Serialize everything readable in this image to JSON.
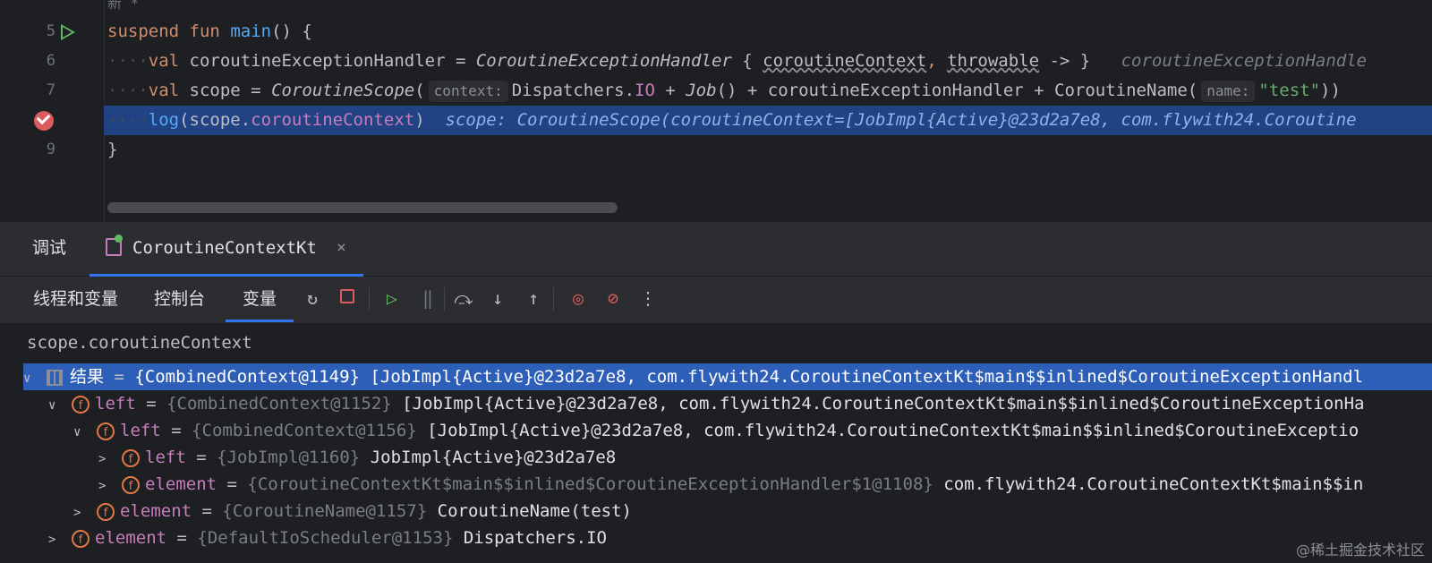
{
  "editor": {
    "header_note": "新 *",
    "lines": [
      {
        "num": "5",
        "text": ""
      },
      {
        "num": "6",
        "text": ""
      },
      {
        "num": "7",
        "text": ""
      },
      {
        "num": "",
        "text": ""
      },
      {
        "num": "9",
        "text": ""
      }
    ],
    "l5": {
      "kw1": "suspend",
      "kw2": "fun",
      "fn": "main",
      "rest": "() {"
    },
    "l6": {
      "kw": "val",
      "name": "coroutineExceptionHandler = ",
      "cls": "CoroutineExceptionHandler",
      "p1": " { ",
      "a1": "coroutineContext",
      "comma": ", ",
      "a2": "throwable",
      "p2": " -> }",
      "inline": "coroutineExceptionHandle"
    },
    "l7": {
      "kw": "val",
      "name": "scope = ",
      "cls": "CoroutineScope",
      "open": "(",
      "hint1": "context:",
      "p1": "Dispatchers.",
      "io": "IO",
      "p2": " + ",
      "job": "Job",
      "p3": "() + coroutineExceptionHandler + CoroutineName(",
      "hint2": "name:",
      "str": "\"test\"",
      "close": "))"
    },
    "l8": {
      "fn": "log",
      "p1": "(scope.",
      "prop": "coroutineContext",
      "p2": ")",
      "inline": "scope: CoroutineScope(coroutineContext=[JobImpl{Active}@23d2a7e8, com.flywith24.Coroutine"
    },
    "l9": {
      "text": "}"
    }
  },
  "debug_tabs": {
    "debug_label": "调试",
    "run_label": "CoroutineContextKt",
    "close": "×"
  },
  "toolbar": {
    "tabs": [
      "线程和变量",
      "控制台",
      "变量"
    ],
    "icons": [
      "rerun-icon",
      "stop-icon",
      "resume-icon",
      "pause-icon",
      "step-over-icon",
      "step-into-icon",
      "step-out-icon",
      "view-breakpoints-icon",
      "mute-breakpoints-icon",
      "more-icon"
    ]
  },
  "variables": {
    "expression": "scope.coroutineContext",
    "rows": [
      {
        "name": "结果",
        "type": "{CombinedContext@1149}",
        "value": "[JobImpl{Active}@23d2a7e8, com.flywith24.CoroutineContextKt$main$$inlined$CoroutineExceptionHandl"
      },
      {
        "name": "left",
        "type": "{CombinedContext@1152}",
        "value": "[JobImpl{Active}@23d2a7e8, com.flywith24.CoroutineContextKt$main$$inlined$CoroutineExceptionHa"
      },
      {
        "name": "left",
        "type": "{CombinedContext@1156}",
        "value": "[JobImpl{Active}@23d2a7e8, com.flywith24.CoroutineContextKt$main$$inlined$CoroutineExceptio"
      },
      {
        "name": "left",
        "type": "{JobImpl@1160}",
        "value": "JobImpl{Active}@23d2a7e8"
      },
      {
        "name": "element",
        "type": "{CoroutineContextKt$main$$inlined$CoroutineExceptionHandler$1@1108}",
        "value": "com.flywith24.CoroutineContextKt$main$$in"
      },
      {
        "name": "element",
        "type": "{CoroutineName@1157}",
        "value": "CoroutineName(test)"
      },
      {
        "name": "element",
        "type": "{DefaultIoScheduler@1153}",
        "value": "Dispatchers.IO"
      }
    ]
  },
  "watermark": "@稀土掘金技术社区",
  "colors": {
    "accent": "#3574f0",
    "selection": "#2e5fb8",
    "line_highlight": "#214283",
    "breakpoint": "#db5c5c"
  }
}
